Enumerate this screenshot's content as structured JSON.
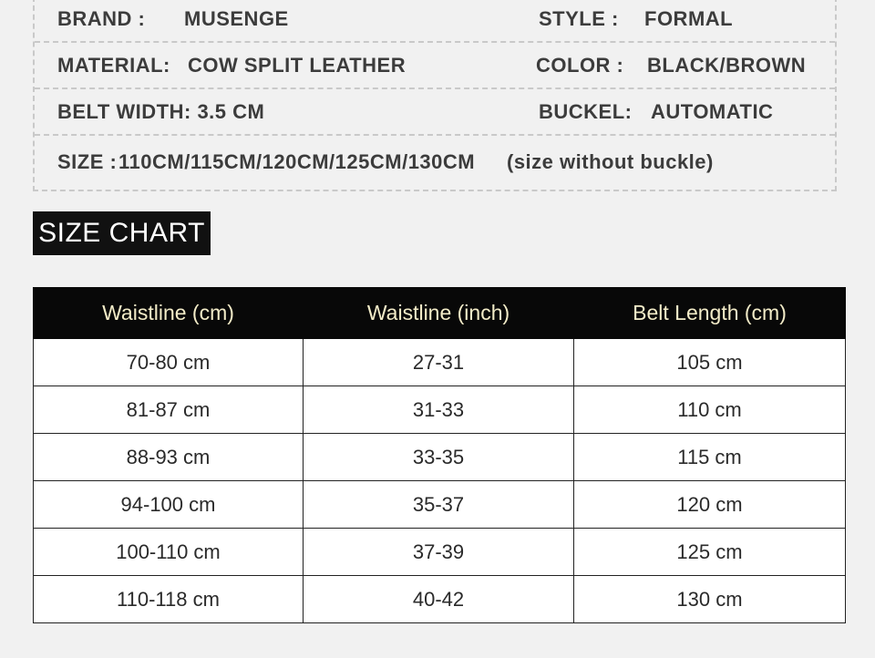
{
  "specs": {
    "brand_label": "BRAND :",
    "brand_value": "MUSENGE",
    "style_label": "STYLE :",
    "style_value": "FORMAL",
    "material_label": "MATERIAL:",
    "material_value": "COW SPLIT LEATHER",
    "color_label": "COLOR :",
    "color_value": "BLACK/BROWN",
    "belt_width": "BELT WIDTH: 3.5 CM",
    "buckle_label": "BUCKEL:",
    "buckle_value": "AUTOMATIC",
    "size_label": "SIZE :",
    "size_values": "110CM/115CM/120CM/125CM/130CM",
    "size_note": "(size without buckle)"
  },
  "size_chart": {
    "title": "SIZE CHART",
    "headers": [
      "Waistline (cm)",
      "Waistline (inch)",
      "Belt Length (cm)"
    ],
    "rows": [
      [
        "70-80 cm",
        "27-31",
        "105 cm"
      ],
      [
        "81-87 cm",
        "31-33",
        "110 cm"
      ],
      [
        "88-93 cm",
        "33-35",
        "115 cm"
      ],
      [
        "94-100 cm",
        "35-37",
        "120 cm"
      ],
      [
        "100-110 cm",
        "37-39",
        "125 cm"
      ],
      [
        "110-118 cm",
        "40-42",
        "130 cm"
      ]
    ]
  }
}
